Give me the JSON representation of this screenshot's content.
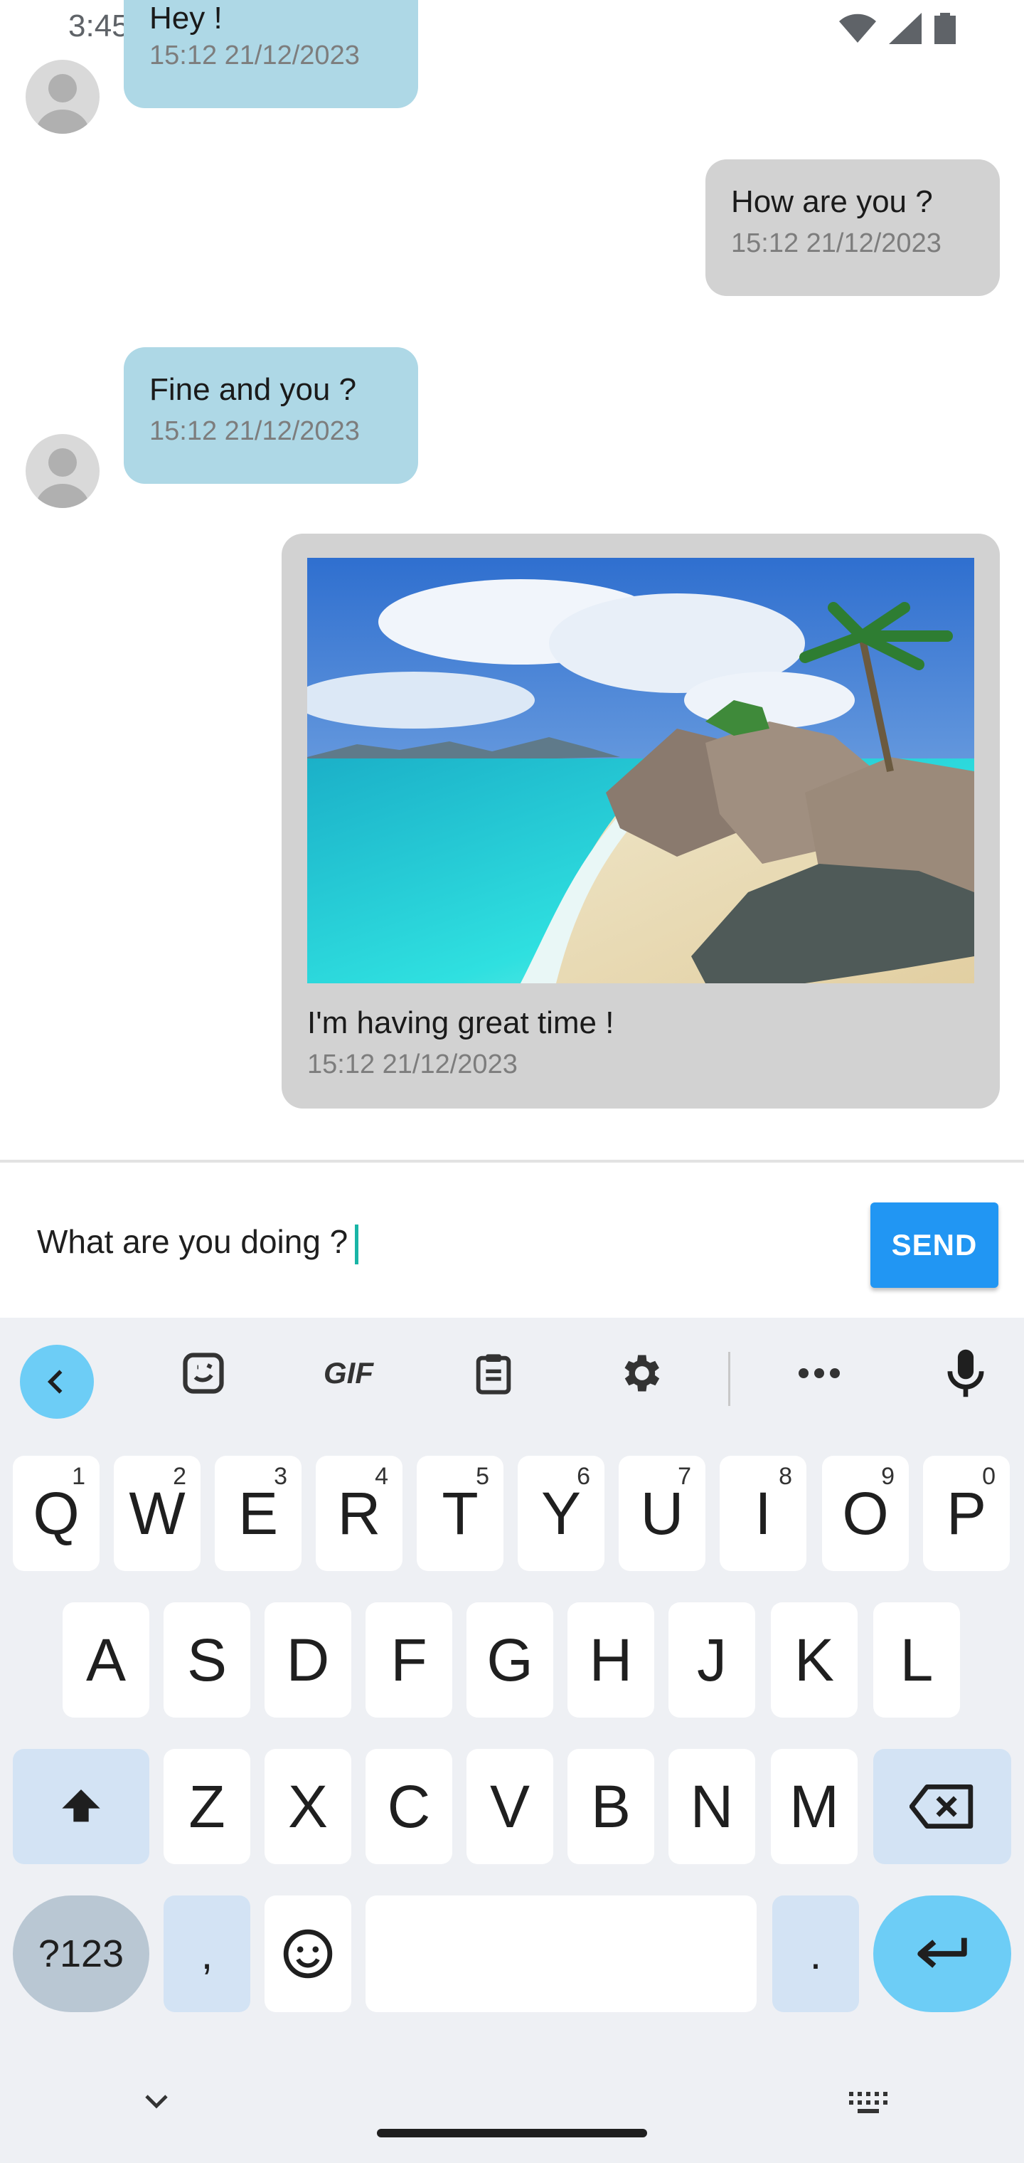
{
  "status_bar": {
    "time": "3:45"
  },
  "messages": [
    {
      "direction": "incoming",
      "text": "Hey !",
      "time": "15:12 21/12/2023"
    },
    {
      "direction": "outgoing",
      "text": "How are you ?",
      "time": "15:12 21/12/2023"
    },
    {
      "direction": "incoming",
      "text": "Fine and you ?",
      "time": "15:12 21/12/2023"
    },
    {
      "direction": "outgoing",
      "text": "I'm having great time !",
      "time": "15:12 21/12/2023",
      "image": "beach-photo"
    }
  ],
  "composer": {
    "input_value": "What are you doing ?",
    "send_label": "SEND"
  },
  "keyboard": {
    "toolbar": [
      "back-icon",
      "sticker-icon",
      "gif-icon",
      "clipboard-icon",
      "settings-icon",
      "more-icon",
      "mic-icon"
    ],
    "gif_label": "GIF",
    "row1": [
      {
        "key": "Q",
        "hint": "1"
      },
      {
        "key": "W",
        "hint": "2"
      },
      {
        "key": "E",
        "hint": "3"
      },
      {
        "key": "R",
        "hint": "4"
      },
      {
        "key": "T",
        "hint": "5"
      },
      {
        "key": "Y",
        "hint": "6"
      },
      {
        "key": "U",
        "hint": "7"
      },
      {
        "key": "I",
        "hint": "8"
      },
      {
        "key": "O",
        "hint": "9"
      },
      {
        "key": "P",
        "hint": "0"
      }
    ],
    "row2": [
      "A",
      "S",
      "D",
      "F",
      "G",
      "H",
      "J",
      "K",
      "L"
    ],
    "row3": [
      "Z",
      "X",
      "C",
      "V",
      "B",
      "N",
      "M"
    ],
    "symbols_label": "?123",
    "comma_label": ",",
    "period_label": "."
  },
  "colors": {
    "incoming_bubble": "#aed8e6",
    "outgoing_bubble": "#d2d2d2",
    "send_button": "#2196f3",
    "enter_key": "#6dcdf6"
  }
}
